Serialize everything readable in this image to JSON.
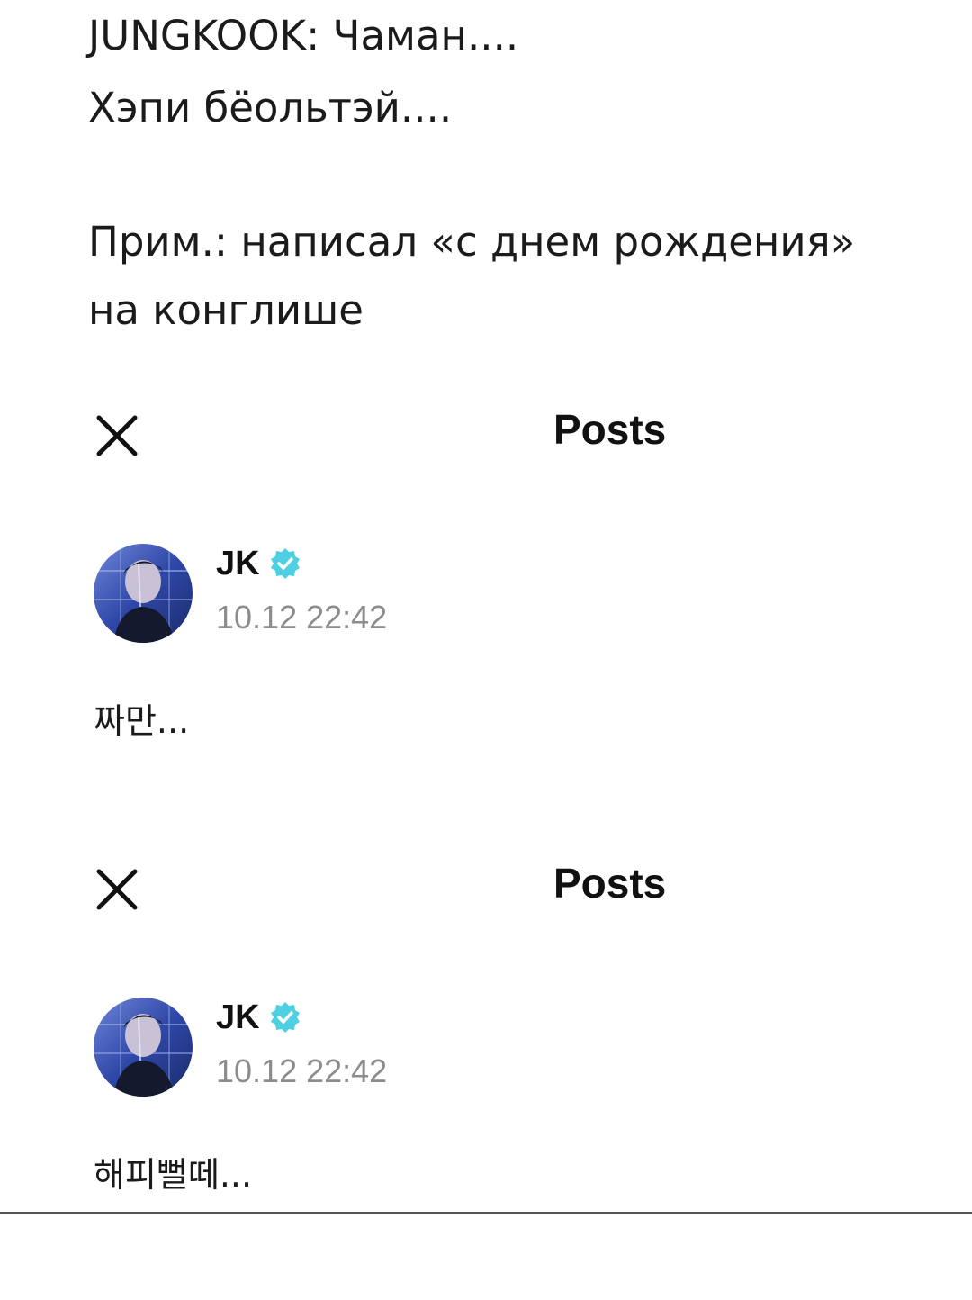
{
  "caption": {
    "line1": "JUNGKOOK: Чаман....",
    "line2": "Хэпи бёольтэй....",
    "line3": "Прим.: написал «с днем рождения»",
    "line4": "на конглише"
  },
  "posts": [
    {
      "header": {
        "close_icon": "close-icon",
        "title": "Posts"
      },
      "author": {
        "name": "JK",
        "verified_icon": "verified-badge-icon",
        "timestamp": "10.12 22:42"
      },
      "body": "짜만..."
    },
    {
      "header": {
        "close_icon": "close-icon",
        "title": "Posts"
      },
      "author": {
        "name": "JK",
        "verified_icon": "verified-badge-icon",
        "timestamp": "10.12 22:42"
      },
      "body": "해피뻘떼..."
    }
  ],
  "colors": {
    "verified_badge": "#4fd0e2",
    "timestamp": "#8c8c8c",
    "avatar_bg": "#2a3f8f"
  }
}
